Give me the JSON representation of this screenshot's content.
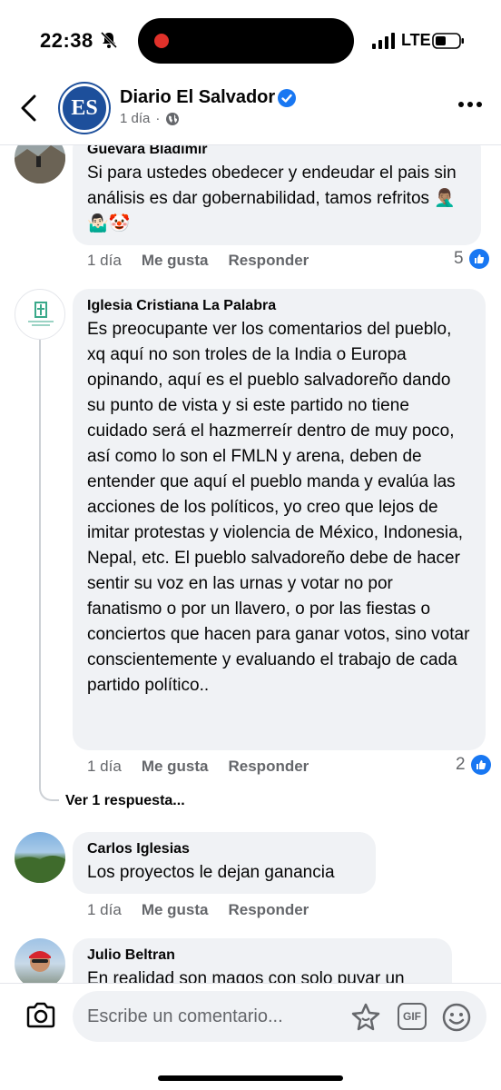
{
  "status": {
    "time": "22:38",
    "network": "LTE"
  },
  "header": {
    "page_name": "Diario El Salvador",
    "logo_text": "ES",
    "time_ago": "1 día",
    "separator": "·"
  },
  "comments": [
    {
      "author": "Guevara Bladimir",
      "text": "Si para ustedes obedecer y endeudar el pais sin análisis es dar gobernabilidad, tamos refritos 🤦🏽‍♂️🤷🏻‍♂️🤡",
      "time": "1 día",
      "like_label": "Me gusta",
      "reply_label": "Responder",
      "likes": "5"
    },
    {
      "author": "Iglesia Cristiana La Palabra",
      "text": "Es preocupante ver los comentarios del pueblo, xq aquí no son troles de la India o Europa opinando, aquí es el pueblo salvadoreño dando su punto de vista y si este partido no tiene cuidado será el hazmerreír dentro de muy poco, así como lo son el FMLN y arena, deben de entender que aquí el pueblo manda y evalúa las acciones de los políticos, yo creo que lejos de imitar protestas y violencia de México, Indonesia, Nepal, etc. El pueblo salvadoreño debe de hacer sentir su voz en las urnas y votar no por fanatismo o por un llavero, o por las fiestas o conciertos que hacen para ganar votos, sino votar conscientemente y evaluando el trabajo de cada partido político..",
      "time": "1 día",
      "like_label": "Me gusta",
      "reply_label": "Responder",
      "likes": "2",
      "view_replies": "Ver 1 respuesta..."
    },
    {
      "author": "Carlos Iglesias",
      "text": "Los proyectos le dejan ganancia",
      "time": "1 día",
      "like_label": "Me gusta",
      "reply_label": "Responder"
    },
    {
      "author": "Julio Beltran",
      "text": "En realidad son magos con solo puyar un"
    }
  ],
  "composer": {
    "placeholder": "Escribe un comentario...",
    "gif_label": "GIF"
  },
  "colors": {
    "accent": "#1877f2",
    "bubble": "#f0f2f5",
    "secondary_text": "#65676b"
  }
}
